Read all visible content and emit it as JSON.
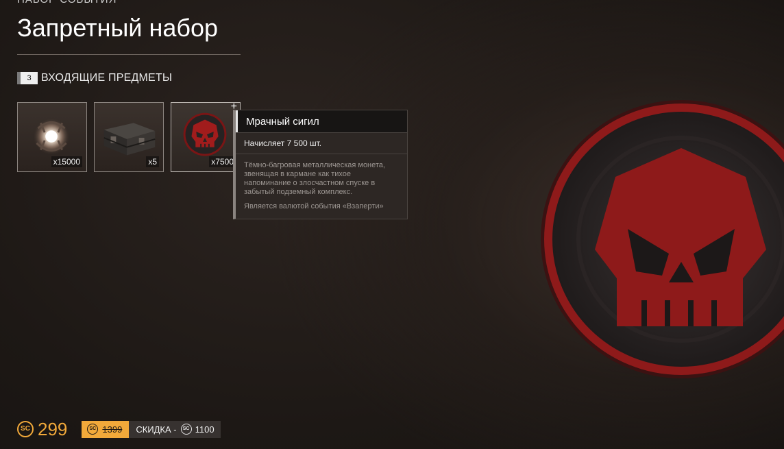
{
  "header": {
    "eyebrow": "НАБОР СОБЫТИЯ",
    "title": "Запретный набор"
  },
  "included": {
    "count": "3",
    "label": "ВХОДЯЩИЕ ПРЕДМЕТЫ"
  },
  "items": [
    {
      "qty": "x15000",
      "icon": "glowing-orb-icon"
    },
    {
      "qty": "x5",
      "icon": "crate-icon"
    },
    {
      "qty": "x7500",
      "icon": "skull-coin-icon",
      "selected": true,
      "plus": "+"
    }
  ],
  "tooltip": {
    "title": "Мрачный сигил",
    "subtitle": "Начисляет 7 500 шт.",
    "description": "Тёмно-багровая металлическая монета, звенящая в кармане как тихое напоминание о злосчастном спуске в забытый подземный комплекс.",
    "note": "Является валютой события «Взаперти»"
  },
  "price": {
    "currency_symbol": "SC",
    "value": "299",
    "old_value": "1399",
    "discount_label": "СКИДКА -",
    "discount_value": "1100"
  },
  "colors": {
    "accent": "#f2a93a",
    "coin_red": "#8e1a1a"
  }
}
